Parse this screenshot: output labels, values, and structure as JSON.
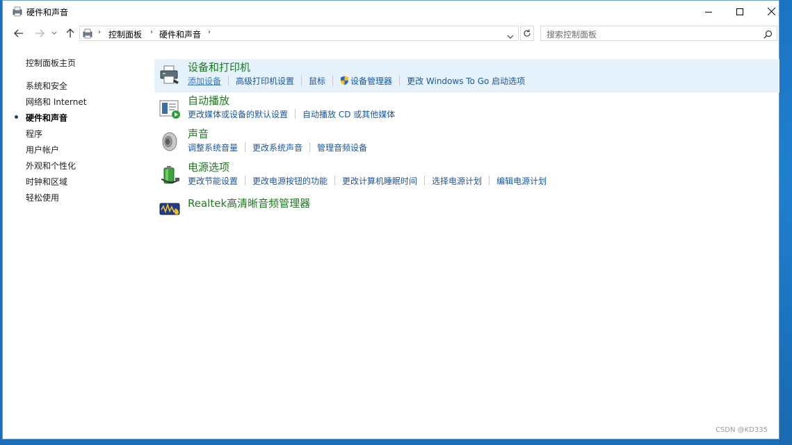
{
  "window": {
    "title": "硬件和声音",
    "controls": {
      "minimize": "minimize-icon",
      "maximize": "maximize-icon",
      "close": "close-icon"
    }
  },
  "address": {
    "crumbs": [
      "控制面板",
      "硬件和声音"
    ],
    "search_placeholder": "搜索控制面板"
  },
  "sidebar": {
    "items": [
      {
        "label": "控制面板主页",
        "current": false
      },
      {
        "label": "系统和安全",
        "current": false
      },
      {
        "label": "网络和 Internet",
        "current": false
      },
      {
        "label": "硬件和声音",
        "current": true
      },
      {
        "label": "程序",
        "current": false
      },
      {
        "label": "用户帐户",
        "current": false
      },
      {
        "label": "外观和个性化",
        "current": false
      },
      {
        "label": "时钟和区域",
        "current": false
      },
      {
        "label": "轻松使用",
        "current": false
      }
    ]
  },
  "categories": [
    {
      "title": "设备和打印机",
      "icon": "printer-icon",
      "links": [
        "添加设备",
        "高级打印机设置",
        "鼠标",
        "设备管理器",
        "更改 Windows To Go 启动选项"
      ]
    },
    {
      "title": "自动播放",
      "icon": "autoplay-icon",
      "links": [
        "更改媒体或设备的默认设置",
        "自动播放 CD 或其他媒体"
      ]
    },
    {
      "title": "声音",
      "icon": "speaker-icon",
      "links": [
        "调整系统音量",
        "更改系统声音",
        "管理音频设备"
      ]
    },
    {
      "title": "电源选项",
      "icon": "battery-icon",
      "links": [
        "更改节能设置",
        "更改电源按钮的功能",
        "更改计算机睡眠时间",
        "选择电源计划",
        "编辑电源计划"
      ]
    },
    {
      "title": "Realtek高清晰音频管理器",
      "icon": "realtek-audio-icon",
      "links": []
    }
  ],
  "watermark": "CSDN @KD335",
  "colors": {
    "link": "#1857a4",
    "category_title": "#1e7a1e",
    "highlight": "#e5f1fb"
  }
}
